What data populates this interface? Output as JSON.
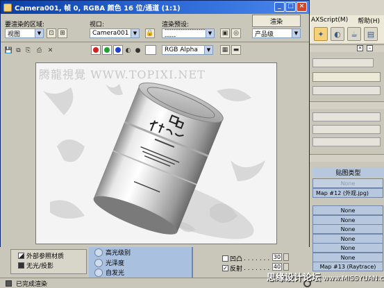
{
  "window": {
    "title": "Camera001, 帧 0, RGBA 颜色 16 位/通道 (1:1)",
    "render_area_label": "要渲染的区域:",
    "render_area_value": "视图",
    "viewport_label": "视口:",
    "viewport_value": "Camera001",
    "preset_label": "渲染预设:",
    "preset_value": "--------------------------",
    "render_button": "渲染",
    "product_level": "产品级",
    "channel_value": "RGB Alpha"
  },
  "background": {
    "menu": [
      "AXScript(M)",
      "帮助(H)"
    ],
    "map_header": "贴图类型",
    "maps": [
      {
        "label": "None",
        "dim": true
      },
      {
        "label": "Map #12 (外观.jpg)",
        "dim": false,
        "named": true
      },
      {
        "label": "None",
        "dim": false
      },
      {
        "label": "None",
        "dim": false
      },
      {
        "label": "None",
        "dim": false
      },
      {
        "label": "None",
        "dim": false
      },
      {
        "label": "None",
        "dim": false
      },
      {
        "label": "None",
        "dim": false
      },
      {
        "label": "Map #13 (Raytrace)",
        "dim": false
      }
    ],
    "left_items": [
      "外部参照材质",
      "无光/投影"
    ],
    "mid_items": [
      "高光级别",
      "光泽度",
      "自发光"
    ],
    "checks": [
      {
        "label": "凹凸",
        "checked": false,
        "value": "30"
      },
      {
        "label": "反射",
        "checked": true,
        "value": "40"
      }
    ]
  },
  "status": {
    "text": "已完成渲染"
  },
  "watermark": {
    "canvas_text": "腾龍視覺 WWW.TOPIXI.NET",
    "bottom_text": "思缘设计论坛",
    "bottom_url": "www.MISSYUAN.com"
  },
  "colors": {
    "titlebar": "#0a3fa4",
    "map_cell": "#b7c7dd",
    "accent": "#2a66d4"
  }
}
